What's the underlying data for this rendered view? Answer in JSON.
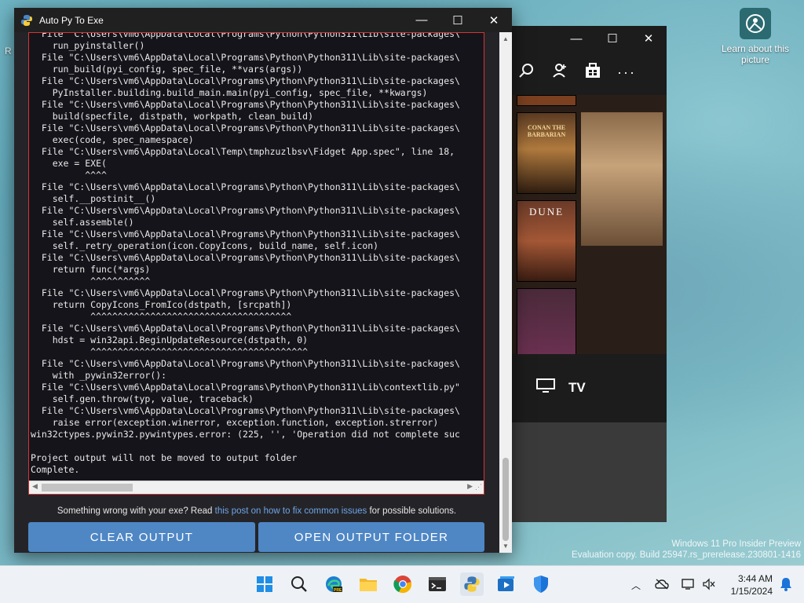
{
  "desktop": {
    "icon_label": "Learn about this picture",
    "left_label": "R",
    "watermark": {
      "line1": "Windows 11 Pro Insider Preview",
      "line2": "Evaluation copy. Build 25947.rs_prerelease.230801-1416"
    }
  },
  "bg_window": {
    "tv_label": "TV",
    "posters": [
      "CONAN THE BARBARIAN",
      "DUNE"
    ]
  },
  "window": {
    "title": "Auto Py To Exe",
    "console_lines": [
      "  File \"C:\\Users\\vm6\\AppData\\Local\\Programs\\Python\\Python311\\Lib\\site-packages\\",
      "    run_pyinstaller()",
      "  File \"C:\\Users\\vm6\\AppData\\Local\\Programs\\Python\\Python311\\Lib\\site-packages\\",
      "    run_build(pyi_config, spec_file, **vars(args))",
      "  File \"C:\\Users\\vm6\\AppData\\Local\\Programs\\Python\\Python311\\Lib\\site-packages\\",
      "    PyInstaller.building.build_main.main(pyi_config, spec_file, **kwargs)",
      "  File \"C:\\Users\\vm6\\AppData\\Local\\Programs\\Python\\Python311\\Lib\\site-packages\\",
      "    build(specfile, distpath, workpath, clean_build)",
      "  File \"C:\\Users\\vm6\\AppData\\Local\\Programs\\Python\\Python311\\Lib\\site-packages\\",
      "    exec(code, spec_namespace)",
      "  File \"C:\\Users\\vm6\\AppData\\Local\\Temp\\tmphzuzlbsv\\Fidget App.spec\", line 18,",
      "    exe = EXE(",
      "          ^^^^",
      "  File \"C:\\Users\\vm6\\AppData\\Local\\Programs\\Python\\Python311\\Lib\\site-packages\\",
      "    self.__postinit__()",
      "  File \"C:\\Users\\vm6\\AppData\\Local\\Programs\\Python\\Python311\\Lib\\site-packages\\",
      "    self.assemble()",
      "  File \"C:\\Users\\vm6\\AppData\\Local\\Programs\\Python\\Python311\\Lib\\site-packages\\",
      "    self._retry_operation(icon.CopyIcons, build_name, self.icon)",
      "  File \"C:\\Users\\vm6\\AppData\\Local\\Programs\\Python\\Python311\\Lib\\site-packages\\",
      "    return func(*args)",
      "           ^^^^^^^^^^^",
      "  File \"C:\\Users\\vm6\\AppData\\Local\\Programs\\Python\\Python311\\Lib\\site-packages\\",
      "    return CopyIcons_FromIco(dstpath, [srcpath])",
      "           ^^^^^^^^^^^^^^^^^^^^^^^^^^^^^^^^^^^^^",
      "  File \"C:\\Users\\vm6\\AppData\\Local\\Programs\\Python\\Python311\\Lib\\site-packages\\",
      "    hdst = win32api.BeginUpdateResource(dstpath, 0)",
      "           ^^^^^^^^^^^^^^^^^^^^^^^^^^^^^^^^^^^^^^^^",
      "  File \"C:\\Users\\vm6\\AppData\\Local\\Programs\\Python\\Python311\\Lib\\site-packages\\",
      "    with _pywin32error():",
      "  File \"C:\\Users\\vm6\\AppData\\Local\\Programs\\Python\\Python311\\Lib\\contextlib.py\"",
      "    self.gen.throw(typ, value, traceback)",
      "  File \"C:\\Users\\vm6\\AppData\\Local\\Programs\\Python\\Python311\\Lib\\site-packages\\",
      "    raise error(exception.winerror, exception.function, exception.strerror)",
      "win32ctypes.pywin32.pywintypes.error: (225, '', 'Operation did not complete suc",
      "",
      "Project output will not be moved to output folder",
      "Complete."
    ],
    "help_prefix": "Something wrong with your exe? Read ",
    "help_link": "this post on how to fix common issues",
    "help_suffix": " for possible solutions.",
    "clear_label": "CLEAR OUTPUT",
    "open_label": "OPEN OUTPUT FOLDER"
  },
  "taskbar": {
    "clock_time": "3:44 AM",
    "clock_date": "1/15/2024",
    "icons": [
      "start-icon",
      "search-icon",
      "edge-icon",
      "file-explorer-icon",
      "chrome-icon",
      "terminal-icon",
      "python-icon",
      "media-player-icon",
      "defender-icon"
    ]
  },
  "colors": {
    "accent_button": "#4f87c5",
    "console_border": "#d43535",
    "link": "#6ea4e6"
  }
}
